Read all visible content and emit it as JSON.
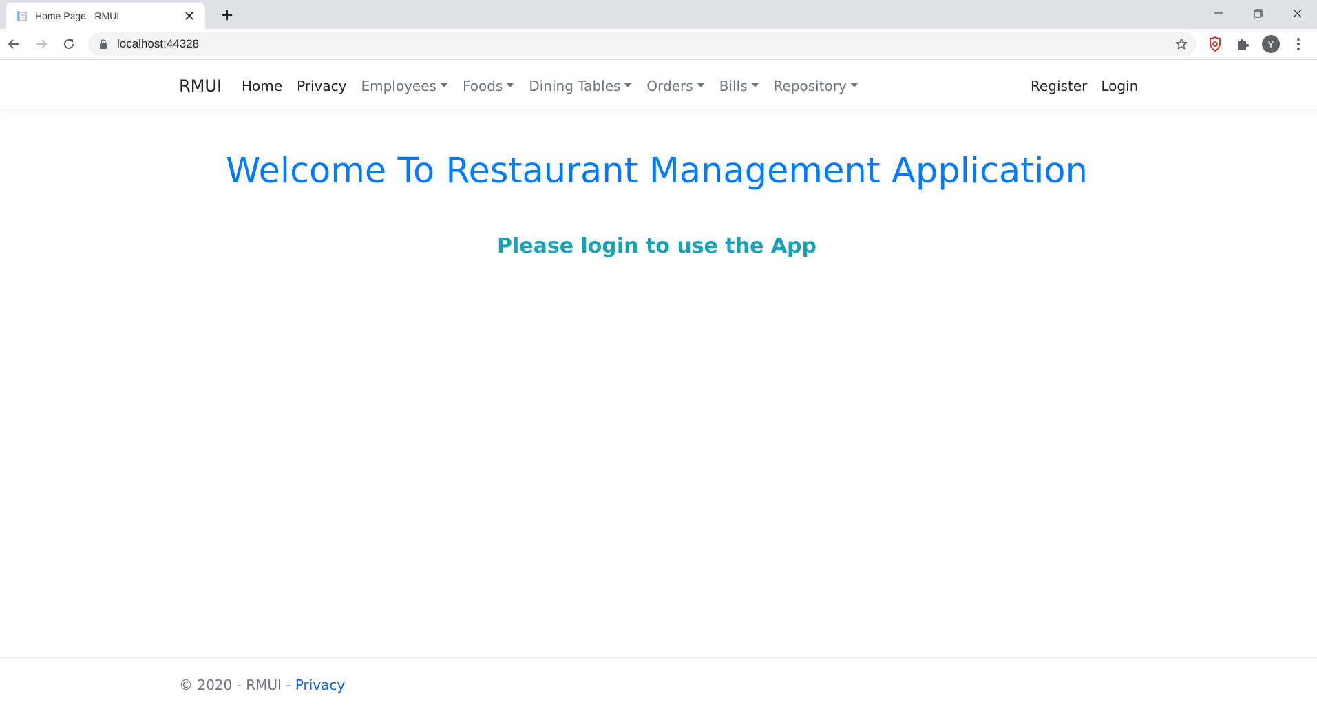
{
  "browser": {
    "tab_title": "Home Page - RMUI",
    "url": "localhost:44328",
    "profile_initial": "Y",
    "icons": {
      "favicon": "document-icon",
      "close": "close-icon",
      "new_tab": "plus-icon",
      "back": "back-arrow-icon",
      "forward": "forward-arrow-icon",
      "reload": "reload-icon",
      "lock": "lock-icon",
      "bookmark": "star-icon",
      "extension_1": "red-shield-extension-icon",
      "extensions": "puzzle-icon",
      "menu": "kebab-menu-icon",
      "minimize": "minimize-icon",
      "restore": "restore-icon",
      "window_close": "close-icon"
    }
  },
  "navbar": {
    "brand": "RMUI",
    "links": [
      {
        "label": "Home",
        "dropdown": false
      },
      {
        "label": "Privacy",
        "dropdown": false
      },
      {
        "label": "Employees",
        "dropdown": true
      },
      {
        "label": "Foods",
        "dropdown": true
      },
      {
        "label": "Dining Tables",
        "dropdown": true
      },
      {
        "label": "Orders",
        "dropdown": true
      },
      {
        "label": "Bills",
        "dropdown": true
      },
      {
        "label": "Repository",
        "dropdown": true
      }
    ],
    "right_links": [
      {
        "label": "Register"
      },
      {
        "label": "Login"
      }
    ]
  },
  "main": {
    "title": "Welcome To Restaurant Management Application",
    "subtitle": "Please login to use the App"
  },
  "footer": {
    "text": "© 2020 - RMUI - ",
    "link": "Privacy"
  },
  "colors": {
    "primary": "#007bff",
    "info": "#17a2b8",
    "muted": "#6c757d",
    "link": "#0366d6"
  }
}
